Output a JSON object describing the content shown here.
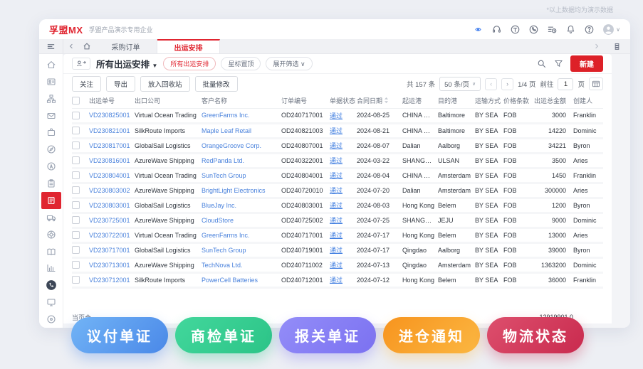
{
  "page": {
    "demo_note": "*以上数据均为演示数据"
  },
  "topbar": {
    "logo": "孚盟MX",
    "company": "孚盟产品演示专用企业",
    "icons": [
      "visibility",
      "headset",
      "ticket",
      "phone",
      "history",
      "bell",
      "help",
      "avatar"
    ]
  },
  "tabbar": {
    "tabs": [
      {
        "label": "采购订单",
        "active": false
      },
      {
        "label": "出运安排",
        "active": true
      }
    ]
  },
  "sidebar": {
    "items": [
      {
        "name": "home",
        "active": false
      },
      {
        "name": "contacts",
        "active": false
      },
      {
        "name": "org",
        "active": false
      },
      {
        "name": "mail",
        "active": false
      },
      {
        "name": "bag",
        "active": false
      },
      {
        "name": "compass",
        "active": false
      },
      {
        "name": "circle-a",
        "active": false
      },
      {
        "name": "clipboard",
        "active": false
      },
      {
        "name": "shipping-doc",
        "active": true
      },
      {
        "name": "truck",
        "active": false
      },
      {
        "name": "lifebuoy",
        "active": false
      },
      {
        "name": "book",
        "active": false
      },
      {
        "name": "chart",
        "active": false
      },
      {
        "name": "whatsapp",
        "active": false
      },
      {
        "name": "monitor",
        "active": false
      },
      {
        "name": "target",
        "active": false
      }
    ]
  },
  "view_header": {
    "title": "所有出运安排",
    "filter_pills": [
      {
        "label": "所有出运安排",
        "active": true,
        "caret": false
      },
      {
        "label": "星标置顶",
        "active": false,
        "caret": false
      },
      {
        "label": "展开筛选",
        "active": false,
        "caret": true
      }
    ],
    "new_button": "新建"
  },
  "toolbar": {
    "buttons": [
      "关注",
      "导出",
      "放入回收站",
      "批量修改"
    ]
  },
  "pagination": {
    "total": "共 157 条",
    "page_size": "50 条/页",
    "page_indicator": "1/4 页",
    "goto_label": "前往",
    "goto_value": "1",
    "goto_unit": "页"
  },
  "table": {
    "headers": [
      "出运单号",
      "出口公司",
      "客户名称",
      "订单编号",
      "单据状态",
      "合同日期",
      "起运港",
      "目的港",
      "运输方式",
      "价格条款",
      "出运总金额",
      "创建人"
    ],
    "sortable_header": "合同日期",
    "rows": [
      [
        "VD230825001",
        "Virtual Ocean Trading",
        "GreenFarms Inc.",
        "OD240717001",
        "通过",
        "2024-08-25",
        "CHINA MA...",
        "Baltimore",
        "BY SEA",
        "FOB",
        "3000",
        "Franklin"
      ],
      [
        "VD230821001",
        "SilkRoute Imports",
        "Maple Leaf Retail",
        "OD240821003",
        "通过",
        "2024-08-21",
        "CHINA MA...",
        "Baltimore",
        "BY SEA",
        "FOB",
        "14220",
        "Dominic"
      ],
      [
        "VD230817001",
        "GlobalSail Logistics",
        "OrangeGroove Corp.",
        "OD240807001",
        "通过",
        "2024-08-07",
        "Dalian",
        "Aalborg",
        "BY SEA",
        "FOB",
        "34221",
        "Byron"
      ],
      [
        "VD230816001",
        "AzureWave Shipping",
        "RedPanda Ltd.",
        "OD240322001",
        "通过",
        "2024-03-22",
        "SHANGHAI",
        "ULSAN",
        "BY SEA",
        "FOB",
        "3500",
        "Aries"
      ],
      [
        "VD230804001",
        "Virtual Ocean Trading",
        "SunTech Group",
        "OD240804001",
        "通过",
        "2024-08-04",
        "CHINA MA...",
        "Amsterdam",
        "BY SEA",
        "FOB",
        "1450",
        "Franklin"
      ],
      [
        "VD230803002",
        "AzureWave Shipping",
        "BrightLight Electronics",
        "OD240720010",
        "通过",
        "2024-07-20",
        "Dalian",
        "Amsterdam",
        "BY SEA",
        "FOB",
        "300000",
        "Aries"
      ],
      [
        "VD230803001",
        "GlobalSail Logistics",
        "BlueJay Inc.",
        "OD240803001",
        "通过",
        "2024-08-03",
        "Hong Kong",
        "Belem",
        "BY SEA",
        "FOB",
        "1200",
        "Byron"
      ],
      [
        "VD230725001",
        "AzureWave Shipping",
        "CloudStore",
        "OD240725002",
        "通过",
        "2024-07-25",
        "SHANGHAI",
        "JEJU",
        "BY SEA",
        "FOB",
        "9000",
        "Dominic"
      ],
      [
        "VD230722001",
        "Virtual Ocean Trading",
        "GreenFarms Inc.",
        "OD240717001",
        "通过",
        "2024-07-17",
        "Hong Kong",
        "Belem",
        "BY SEA",
        "FOB",
        "13000",
        "Aries"
      ],
      [
        "VD230717001",
        "GlobalSail Logistics",
        "SunTech Group",
        "OD240719001",
        "通过",
        "2024-07-17",
        "Qingdao",
        "Aalborg",
        "BY SEA",
        "FOB",
        "39000",
        "Byron"
      ],
      [
        "VD230713001",
        "AzureWave Shipping",
        "TechNova Ltd.",
        "OD240711002",
        "通过",
        "2024-07-13",
        "Qingdao",
        "Amsterdam",
        "BY SEA",
        "FOB",
        "1363200",
        "Dominic"
      ],
      [
        "VD230712001",
        "SilkRoute Imports",
        "PowerCell Batteries",
        "OD240712001",
        "通过",
        "2024-07-12",
        "Hong Kong",
        "Belem",
        "BY SEA",
        "FOB",
        "36000",
        "Franklin"
      ]
    ]
  },
  "footer": {
    "page_total_label": "当页合",
    "page_total_value": "12919901.0"
  },
  "action_buttons": [
    {
      "label": "议付单证",
      "gradient_from": "#72b4f6",
      "gradient_to": "#4a88e8"
    },
    {
      "label": "商检单证",
      "gradient_from": "#42d79c",
      "gradient_to": "#2cc487"
    },
    {
      "label": "报关单证",
      "gradient_from": "#938df8",
      "gradient_to": "#7b71f1"
    },
    {
      "label": "进仓通知",
      "gradient_from": "#f7941e",
      "gradient_to": "#fbb742"
    },
    {
      "label": "物流状态",
      "gradient_from": "#dd4f6d",
      "gradient_to": "#c92a4e"
    }
  ],
  "colors": {
    "accent_red": "#e02530",
    "link_blue": "#4a82dc",
    "status_blue": "#3f7de0"
  }
}
